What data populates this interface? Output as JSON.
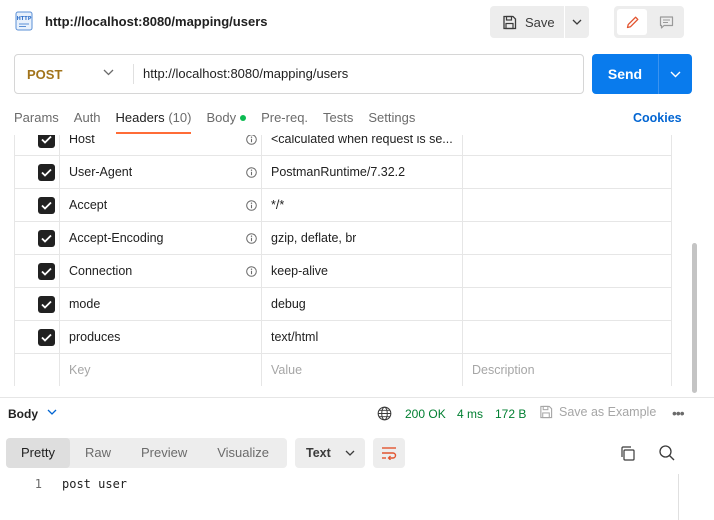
{
  "request": {
    "title": "http://localhost:8080/mapping/users",
    "method": "POST",
    "url": "http://localhost:8080/mapping/users",
    "save_label": "Save",
    "send_label": "Send"
  },
  "tabs": {
    "params": "Params",
    "auth": "Auth",
    "headers": "Headers",
    "headers_count": "(10)",
    "body": "Body",
    "prereq": "Pre-req.",
    "tests": "Tests",
    "settings": "Settings",
    "cookies": "Cookies",
    "active": "Headers"
  },
  "headers": [
    {
      "key": "Host",
      "value": "<calculated when request is se...",
      "checked": true,
      "info": true
    },
    {
      "key": "User-Agent",
      "value": "PostmanRuntime/7.32.2",
      "checked": true,
      "info": true
    },
    {
      "key": "Accept",
      "value": "*/*",
      "checked": true,
      "info": true
    },
    {
      "key": "Accept-Encoding",
      "value": "gzip, deflate, br",
      "checked": true,
      "info": true
    },
    {
      "key": "Connection",
      "value": "keep-alive",
      "checked": true,
      "info": true
    },
    {
      "key": "mode",
      "value": "debug",
      "checked": true,
      "info": false
    },
    {
      "key": "produces",
      "value": "text/html",
      "checked": true,
      "info": false
    }
  ],
  "new_header": {
    "key_placeholder": "Key",
    "value_placeholder": "Value",
    "description_placeholder": "Description"
  },
  "response": {
    "body_label": "Body",
    "status": "200 OK",
    "time": "4 ms",
    "size": "172 B",
    "save_example": "Save as Example",
    "views": [
      "Pretty",
      "Raw",
      "Preview",
      "Visualize"
    ],
    "active_view": "Pretty",
    "format": "Text",
    "line_number": "1",
    "code": "post user"
  },
  "colors": {
    "send": "#097bed",
    "method": "#a2741b",
    "active_tab_underline": "#ff6c37",
    "status_ok": "#007f31",
    "link": "#0265d2",
    "body_dot": "#0cbb52"
  },
  "icons": [
    "http-file-icon",
    "save-icon",
    "chevron-down-icon",
    "edit-pencil-icon",
    "comment-icon",
    "check-icon",
    "info-icon",
    "globe-icon",
    "save-example-icon",
    "more-icon",
    "wrap-lines-icon",
    "copy-icon",
    "search-icon"
  ]
}
